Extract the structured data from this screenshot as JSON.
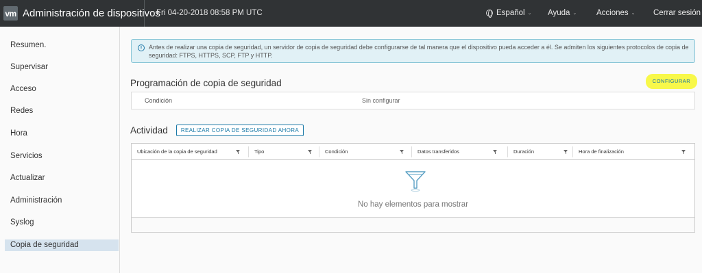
{
  "header": {
    "logo": "vm",
    "title": "Administración de dispositivos",
    "datetime": "Fri 04-20-2018 08:58 PM UTC",
    "nav": [
      {
        "label": "Español",
        "icon": "globe-icon"
      },
      {
        "label": "Ayuda"
      },
      {
        "label": "Acciones"
      },
      {
        "label": "Cerrar sesión"
      }
    ]
  },
  "sidebar": {
    "items": [
      {
        "label": "Resumen."
      },
      {
        "label": "Supervisar"
      },
      {
        "label": "Acceso"
      },
      {
        "label": "Redes"
      },
      {
        "label": "Hora"
      },
      {
        "label": "Servicios"
      },
      {
        "label": "Actualizar"
      },
      {
        "label": "Administración"
      },
      {
        "label": "Syslog"
      },
      {
        "label": "Copia de seguridad",
        "active": true
      }
    ]
  },
  "alert": {
    "icon": "info-icon",
    "text": "Antes de realizar una copia de seguridad, un servidor de copia de seguridad debe configurarse de tal manera que el dispositivo pueda acceder a él. Se admiten los siguientes protocolos de copia de seguridad: FTPS, HTTPS, SCP, FTP y HTTP."
  },
  "schedule": {
    "title": "Programación de copia de seguridad",
    "configure_label": "CONFIGURAR",
    "status_label": "Condición",
    "status_value": "Sin configurar"
  },
  "activity": {
    "title": "Actividad",
    "backup_now_label": "REALIZAR COPIA DE SEGURIDAD AHORA",
    "columns": [
      {
        "label": "Ubicación de la copia de seguridad"
      },
      {
        "label": "Tipo"
      },
      {
        "label": "Condición"
      },
      {
        "label": "Datos transferidos"
      },
      {
        "label": "Duración"
      },
      {
        "label": "Hora de finalización"
      }
    ],
    "empty_icon": "filter-funnel-icon",
    "empty_text": "No hay elementos para mostrar"
  },
  "colors": {
    "header_bg": "#303335",
    "accent": "#1a79a7",
    "highlight": "#f8f84a",
    "active_item_bg": "#d6e3ee"
  }
}
